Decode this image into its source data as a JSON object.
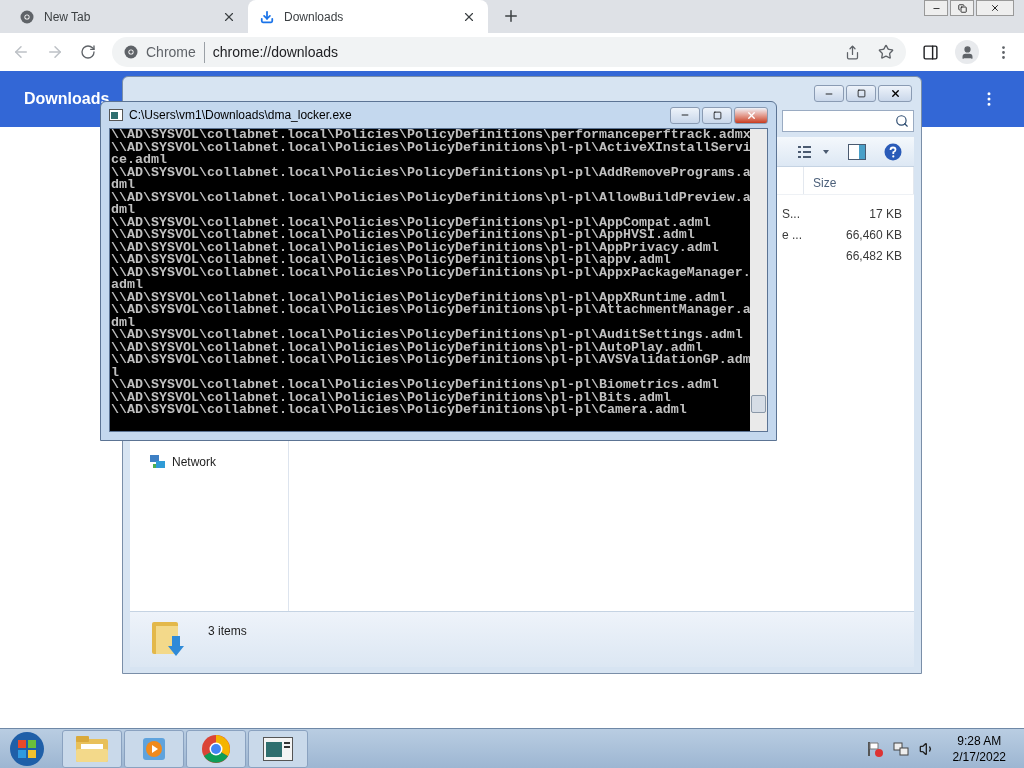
{
  "browser": {
    "tabs": [
      {
        "title": "New Tab",
        "kind": "newtab",
        "selected": false
      },
      {
        "title": "Downloads",
        "kind": "downloads",
        "selected": true
      }
    ],
    "address": {
      "scheme_label": "Chrome",
      "url": "chrome://downloads"
    },
    "page_title": "Downloads"
  },
  "explorer": {
    "columns": [
      {
        "label": "Size"
      }
    ],
    "files": [
      {
        "name": "S...",
        "size": "17 KB"
      },
      {
        "name": "e ...",
        "size": "66,460 KB"
      },
      {
        "size": "66,482 KB"
      }
    ],
    "nav_items": [
      {
        "label": "Network"
      }
    ],
    "status": "3 items"
  },
  "console": {
    "title": "C:\\Users\\vm1\\Downloads\\dma_locker.exe",
    "lines": [
      "\\\\AD\\SYSVOL\\collabnet.local\\Policies\\PolicyDefinitions\\performanceperftrack.admx",
      "\\\\AD\\SYSVOL\\collabnet.local\\Policies\\PolicyDefinitions\\pl-pl\\ActiveXInstallService.adml",
      "\\\\AD\\SYSVOL\\collabnet.local\\Policies\\PolicyDefinitions\\pl-pl\\AddRemovePrograms.adml",
      "\\\\AD\\SYSVOL\\collabnet.local\\Policies\\PolicyDefinitions\\pl-pl\\AllowBuildPreview.adml",
      "\\\\AD\\SYSVOL\\collabnet.local\\Policies\\PolicyDefinitions\\pl-pl\\AppCompat.adml",
      "\\\\AD\\SYSVOL\\collabnet.local\\Policies\\PolicyDefinitions\\pl-pl\\AppHVSI.adml",
      "\\\\AD\\SYSVOL\\collabnet.local\\Policies\\PolicyDefinitions\\pl-pl\\AppPrivacy.adml",
      "\\\\AD\\SYSVOL\\collabnet.local\\Policies\\PolicyDefinitions\\pl-pl\\appv.adml",
      "\\\\AD\\SYSVOL\\collabnet.local\\Policies\\PolicyDefinitions\\pl-pl\\AppxPackageManager.adml",
      "\\\\AD\\SYSVOL\\collabnet.local\\Policies\\PolicyDefinitions\\pl-pl\\AppXRuntime.adml",
      "\\\\AD\\SYSVOL\\collabnet.local\\Policies\\PolicyDefinitions\\pl-pl\\AttachmentManager.adml",
      "\\\\AD\\SYSVOL\\collabnet.local\\Policies\\PolicyDefinitions\\pl-pl\\AuditSettings.adml",
      "\\\\AD\\SYSVOL\\collabnet.local\\Policies\\PolicyDefinitions\\pl-pl\\AutoPlay.adml",
      "\\\\AD\\SYSVOL\\collabnet.local\\Policies\\PolicyDefinitions\\pl-pl\\AVSValidationGP.adml",
      "\\\\AD\\SYSVOL\\collabnet.local\\Policies\\PolicyDefinitions\\pl-pl\\Biometrics.adml",
      "\\\\AD\\SYSVOL\\collabnet.local\\Policies\\PolicyDefinitions\\pl-pl\\Bits.adml",
      "\\\\AD\\SYSVOL\\collabnet.local\\Policies\\PolicyDefinitions\\pl-pl\\Camera.adml"
    ]
  },
  "taskbar": {
    "apps": [
      {
        "kind": "explorer"
      },
      {
        "kind": "media"
      },
      {
        "kind": "chrome"
      },
      {
        "kind": "console"
      }
    ],
    "time": "9:28 AM",
    "date": "2/17/2022"
  }
}
